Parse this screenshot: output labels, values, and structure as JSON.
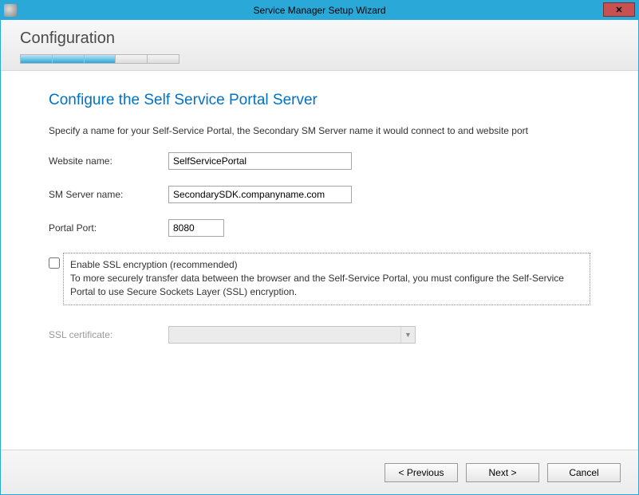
{
  "window": {
    "title": "Service Manager Setup Wizard"
  },
  "header": {
    "section": "Configuration",
    "progress_segments": [
      "done",
      "done",
      "done",
      "todo",
      "todo"
    ]
  },
  "page": {
    "heading": "Configure the Self Service Portal Server",
    "instruction": "Specify a name for your Self-Service Portal, the Secondary SM Server name it would connect to and website port"
  },
  "fields": {
    "website_label": "Website name:",
    "website_value": "SelfServicePortal",
    "smserver_label": "SM Server name:",
    "smserver_value": "SecondarySDK.companyname.com",
    "port_label": "Portal Port:",
    "port_value": "8080"
  },
  "ssl": {
    "checkbox_label": "Enable SSL encryption (recommended)",
    "description": "To more securely transfer data between the browser and the Self-Service Portal, you must configure the Self-Service Portal to use Secure Sockets Layer (SSL) encryption.",
    "cert_label": "SSL certificate:"
  },
  "buttons": {
    "previous": "< Previous",
    "next": "Next >",
    "cancel": "Cancel"
  }
}
